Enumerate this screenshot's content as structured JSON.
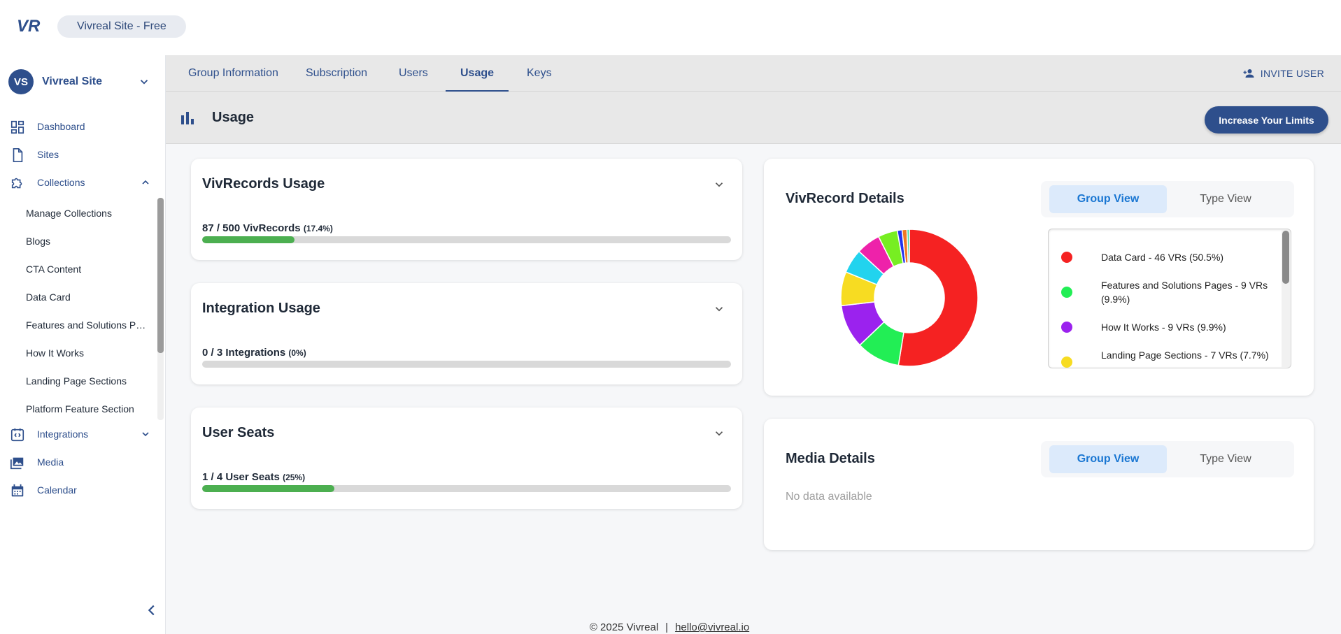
{
  "header": {
    "logo_text": "VR",
    "site_pill": "Vivreal Site - Free"
  },
  "sidebar": {
    "account": {
      "initials": "VS",
      "name": "Vivreal Site"
    },
    "items": [
      {
        "label": "Dashboard",
        "icon": "dashboard-icon"
      },
      {
        "label": "Sites",
        "icon": "file-icon"
      },
      {
        "label": "Collections",
        "icon": "puzzle-icon",
        "expanded": true
      },
      {
        "label": "Integrations",
        "icon": "integration-icon"
      },
      {
        "label": "Media",
        "icon": "photo-library-icon"
      },
      {
        "label": "Calendar",
        "icon": "calendar-icon"
      }
    ],
    "collections": [
      "Manage Collections",
      "Blogs",
      "CTA Content",
      "Data Card",
      "Features and Solutions Pages",
      "How It Works",
      "Landing Page Sections",
      "Platform Feature Section"
    ]
  },
  "tabs": [
    "Group Information",
    "Subscription",
    "Users",
    "Usage",
    "Keys"
  ],
  "active_tab": "Usage",
  "invite_label": "INVITE USER",
  "page": {
    "title": "Usage",
    "increase_button": "Increase Your Limits"
  },
  "usage_cards": [
    {
      "title": "VivRecords Usage",
      "used": "87 / 500 VivRecords",
      "pct": "(17.4%)",
      "fraction": 0.174
    },
    {
      "title": "Integration Usage",
      "used": "0 / 3 Integrations",
      "pct": "(0%)",
      "fraction": 0
    },
    {
      "title": "User Seats",
      "used": "1 / 4 User Seats",
      "pct": "(25%)",
      "fraction": 0.25
    }
  ],
  "vivrecord_details": {
    "title": "VivRecord Details",
    "toggle": {
      "on": "Group View",
      "off": "Type View"
    },
    "legend": [
      {
        "text": "Data Card - 46 VRs (50.5%)",
        "color": "#f52222"
      },
      {
        "text": "Features and Solutions Pages - 9 VRs (9.9%)",
        "color": "#22ee55"
      },
      {
        "text": "How It Works - 9 VRs (9.9%)",
        "color": "#9b22ee"
      },
      {
        "text": "Landing Page Sections - 7 VRs (7.7%)",
        "color": "#f7dc22"
      }
    ],
    "chart_data": {
      "type": "pie",
      "donut": true,
      "slices": [
        {
          "value": 46,
          "color": "#f52222"
        },
        {
          "value": 9,
          "color": "#22ee55"
        },
        {
          "value": 9,
          "color": "#9b22ee"
        },
        {
          "value": 7,
          "color": "#f7dc22"
        },
        {
          "value": 5,
          "color": "#22d3ee"
        },
        {
          "value": 5,
          "color": "#ee22aa"
        },
        {
          "value": 4,
          "color": "#77ee22"
        },
        {
          "value": 1,
          "color": "#2233ee"
        },
        {
          "value": 1,
          "color": "#f07822"
        },
        {
          "value": 0.5,
          "color": "#44ddaa"
        }
      ]
    }
  },
  "media_details": {
    "title": "Media Details",
    "toggle": {
      "on": "Group View",
      "off": "Type View"
    },
    "empty_text": "No data available"
  },
  "footer": {
    "copyright": "© 2025 Vivreal",
    "separator": "|",
    "email": "hello@vivreal.io"
  }
}
